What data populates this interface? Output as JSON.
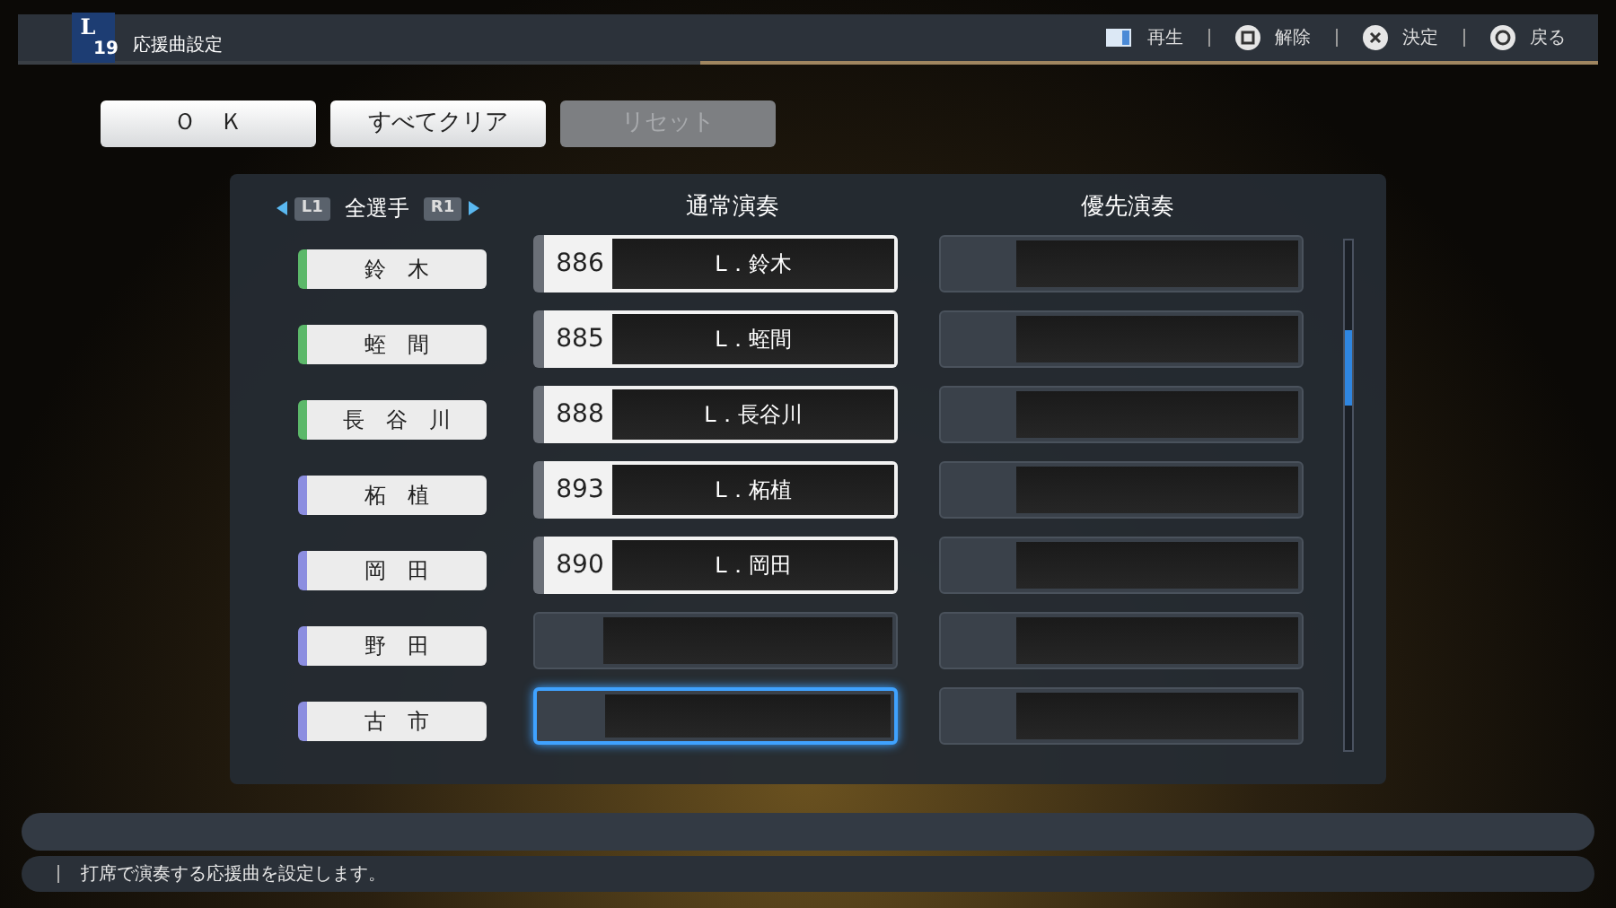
{
  "header": {
    "logo_letter": "L",
    "logo_number": "19",
    "title": "応援曲設定",
    "hints": [
      {
        "kind": "touchpad",
        "label": "再生"
      },
      {
        "kind": "square",
        "label": "解除"
      },
      {
        "kind": "cross",
        "label": "決定"
      },
      {
        "kind": "circle",
        "label": "戻る"
      }
    ]
  },
  "actions": [
    {
      "label": "Ｏ　Ｋ",
      "disabled": false
    },
    {
      "label": "すべてクリア",
      "disabled": false
    },
    {
      "label": "リセット",
      "disabled": true
    }
  ],
  "filter": {
    "prev_key": "L1",
    "label": "全選手",
    "next_key": "R1"
  },
  "columns": [
    "通常演奏",
    "優先演奏"
  ],
  "rows": [
    {
      "player": "鈴　木",
      "color": "#5cb86a",
      "normal": {
        "number": "886",
        "song": "L．鈴木",
        "selected": false
      },
      "priority": {
        "selected": false
      }
    },
    {
      "player": "蛭　間",
      "color": "#5cb86a",
      "normal": {
        "number": "885",
        "song": "L．蛭間",
        "selected": false
      },
      "priority": {
        "selected": false
      }
    },
    {
      "player": "長　谷　川",
      "color": "#5cb86a",
      "normal": {
        "number": "888",
        "song": "L．長谷川",
        "selected": false
      },
      "priority": {
        "selected": false
      }
    },
    {
      "player": "柘　植",
      "color": "#8c8ee0",
      "normal": {
        "number": "893",
        "song": "L．柘植",
        "selected": false
      },
      "priority": {
        "selected": false
      }
    },
    {
      "player": "岡　田",
      "color": "#8c8ee0",
      "normal": {
        "number": "890",
        "song": "L．岡田",
        "selected": false
      },
      "priority": {
        "selected": false
      }
    },
    {
      "player": "野　田",
      "color": "#8c8ee0",
      "normal": {
        "selected": false
      },
      "priority": {
        "selected": false
      }
    },
    {
      "player": "古　市",
      "color": "#8c8ee0",
      "normal": {
        "selected": true
      },
      "priority": {
        "selected": false
      }
    }
  ],
  "help_text": "打席で演奏する応援曲を設定します。"
}
